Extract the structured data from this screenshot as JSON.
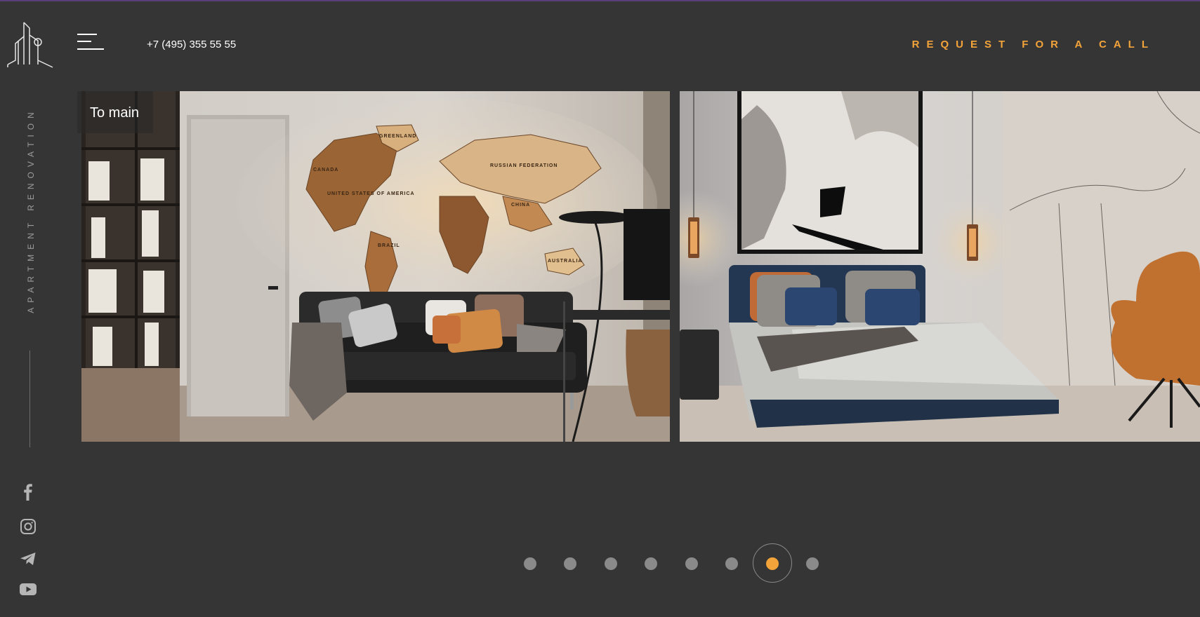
{
  "header": {
    "phone": "+7 (495) 355 55 55",
    "cta_label": "REQUEST FOR A CALL"
  },
  "sidebar": {
    "caption": "APARTMENT RENOVATION",
    "social": [
      "facebook-icon",
      "instagram-icon",
      "telegram-icon",
      "youtube-icon"
    ]
  },
  "slider": {
    "to_main_label": "To main",
    "slides": [
      {
        "name": "living-room-with-world-map",
        "map_labels": [
          "CANADA",
          "GREENLAND",
          "RUSSIAN FEDERATION",
          "CHINA",
          "UNITED STATES OF AMERICA",
          "BRAZIL",
          "AUSTRALIA"
        ]
      },
      {
        "name": "bedroom-with-orange-chair"
      }
    ],
    "pagination": {
      "count": 8,
      "active_index": 6
    }
  },
  "colors": {
    "background": "#353535",
    "accent": "#f2a33a",
    "muted": "#8a8a8a"
  }
}
